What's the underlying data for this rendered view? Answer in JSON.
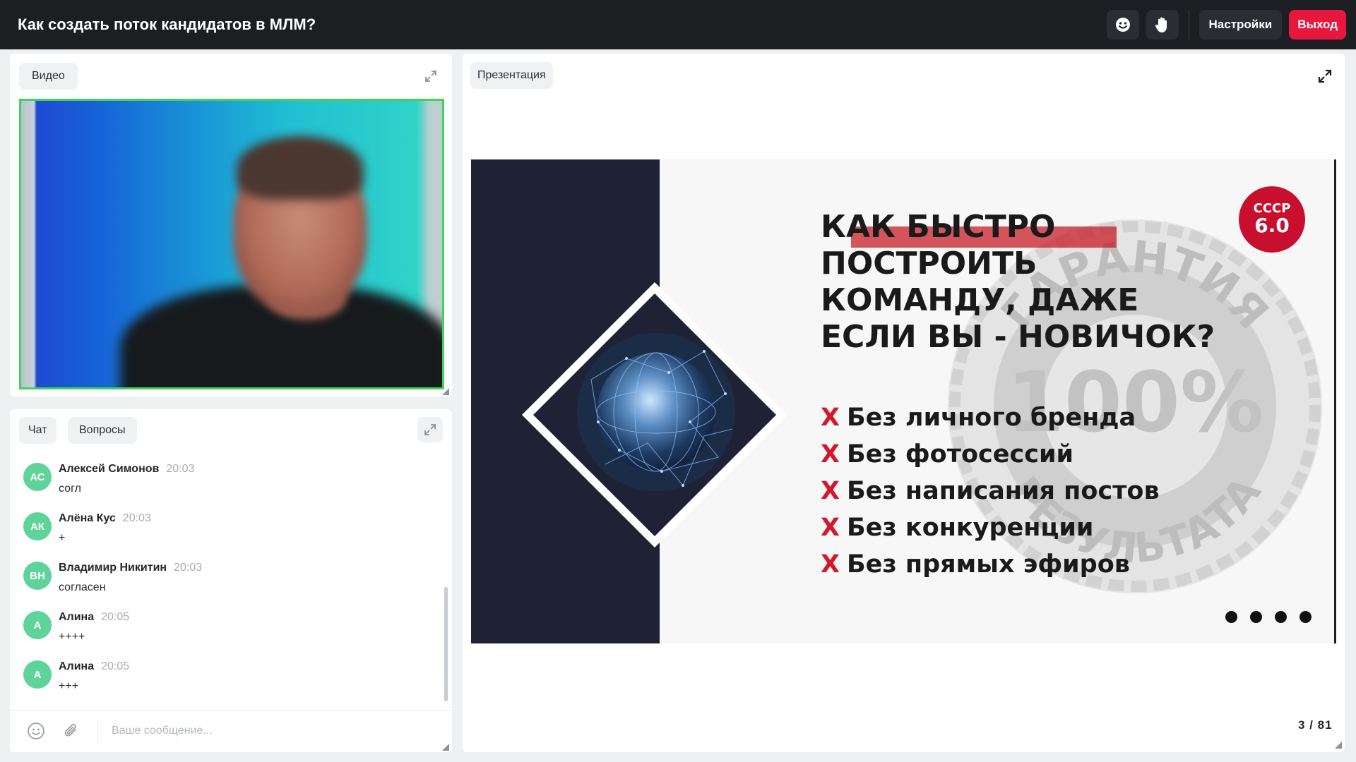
{
  "header": {
    "title": "Как создать поток кандидатов в МЛМ?",
    "settings_label": "Настройки",
    "exit_label": "Выход",
    "emoji_icon": "smiley-icon",
    "hand_icon": "raise-hand-icon",
    "colors": {
      "bar": "#1d1e22",
      "exit": "#e8173e"
    }
  },
  "video_panel": {
    "tab_label": "Видео",
    "expand_icon": "expand-icon",
    "active_border_color": "#3fd25c"
  },
  "chat_panel": {
    "tabs": [
      {
        "label": "Чат"
      },
      {
        "label": "Вопросы"
      }
    ],
    "messages": [
      {
        "initials": "АС",
        "author": "Алексей Симонов",
        "time": "20:03",
        "text": "согл"
      },
      {
        "initials": "АК",
        "author": "Алёна Кус",
        "time": "20:03",
        "text": "+"
      },
      {
        "initials": "ВН",
        "author": "Владимир Никитин",
        "time": "20:03",
        "text": "согласен"
      },
      {
        "initials": "А",
        "author": "Алина",
        "time": "20:05",
        "text": "++++"
      },
      {
        "initials": "А",
        "author": "Алина",
        "time": "20:05",
        "text": "+++"
      }
    ],
    "input_placeholder": "Ваше сообщение...",
    "emoji_icon": "smiley-icon",
    "attach_icon": "paperclip-icon"
  },
  "presentation_panel": {
    "tab_label": "Презентация",
    "page_counter": "3 / 81",
    "slide": {
      "headline_lines": [
        "КАК БЫСТРО",
        "ПОСТРОИТЬ",
        "КОМАНДУ, ДАЖЕ",
        "ЕСЛИ ВЫ - НОВИЧОК?"
      ],
      "bullet_marker": "Х",
      "bullets": [
        "Без личного бренда",
        "Без фотосессий",
        "Без написания постов",
        "Без конкуренции",
        "Без прямых эфиров"
      ],
      "logo_line1": "СССР",
      "logo_line2": "6.0",
      "watermark_top": "ГАРАНТИЯ",
      "watermark_center": "100%",
      "watermark_bottom": "РЕЗУЛЬТАТА",
      "colors": {
        "accent": "#d4172b",
        "dark": "#1f2235"
      }
    }
  }
}
